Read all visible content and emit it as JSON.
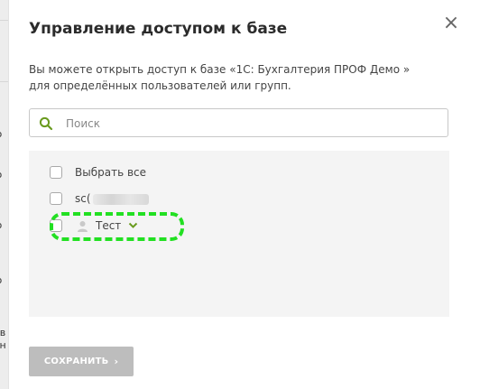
{
  "background": {
    "fragments": [
      "ю",
      "ю",
      "ю",
      "ю",
      "ов",
      "ун"
    ]
  },
  "dialog": {
    "title": "Управление доступом к базе",
    "close_label": "×",
    "description": "Вы можете открыть доступ к базе «1С: Бухгалтерия ПРОФ Демо » для определённых пользователей или групп.",
    "search": {
      "placeholder": "Поиск",
      "value": ""
    },
    "list": {
      "select_all_label": "Выбрать все",
      "user_prefix": "sc(",
      "group_label": "Тест"
    },
    "save_label": "СОХРАНИТЬ",
    "save_arrow": "›"
  },
  "colors": {
    "accent_green": "#6a9b1f",
    "highlight_green": "#22e022",
    "button_disabled": "#bdbdbd"
  },
  "icons": {
    "search": "search-icon",
    "user": "user-icon",
    "chevron": "chevron-down-icon",
    "close": "close-icon"
  }
}
